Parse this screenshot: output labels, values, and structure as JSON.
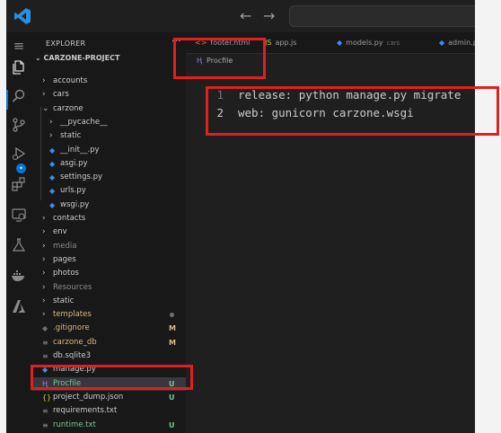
{
  "explorer": {
    "title": "EXPLORER",
    "more": "···",
    "project": "CARZONE-PROJECT",
    "items": [
      {
        "label": "accounts",
        "kind": "folder",
        "color": "#cccccc",
        "status": ""
      },
      {
        "label": "cars",
        "kind": "folder",
        "color": "#cccccc",
        "status": ""
      },
      {
        "label": "carzone",
        "kind": "folder-open",
        "color": "#cccccc",
        "status": ""
      },
      {
        "label": "__pycache__",
        "kind": "folder",
        "color": "#cccccc",
        "status": ""
      },
      {
        "label": "static",
        "kind": "folder",
        "color": "#cccccc",
        "status": ""
      },
      {
        "label": "__init__.py",
        "kind": "python",
        "color": "#cccccc",
        "status": ""
      },
      {
        "label": "asgi.py",
        "kind": "python",
        "color": "#cccccc",
        "status": ""
      },
      {
        "label": "settings.py",
        "kind": "python",
        "color": "#cccccc",
        "status": ""
      },
      {
        "label": "urls.py",
        "kind": "python",
        "color": "#cccccc",
        "status": ""
      },
      {
        "label": "wsgi.py",
        "kind": "python",
        "color": "#cccccc",
        "status": ""
      },
      {
        "label": "contacts",
        "kind": "folder",
        "color": "#cccccc",
        "status": ""
      },
      {
        "label": "env",
        "kind": "folder",
        "color": "#cccccc",
        "status": ""
      },
      {
        "label": "media",
        "kind": "folder",
        "color": "#8b8b8b",
        "status": ""
      },
      {
        "label": "pages",
        "kind": "folder",
        "color": "#cccccc",
        "status": ""
      },
      {
        "label": "photos",
        "kind": "folder",
        "color": "#cccccc",
        "status": ""
      },
      {
        "label": "Resources",
        "kind": "folder",
        "color": "#8b8b8b",
        "status": ""
      },
      {
        "label": "static",
        "kind": "folder",
        "color": "#cccccc",
        "status": ""
      },
      {
        "label": "templates",
        "kind": "folder",
        "color": "#d7ba7d",
        "status": "dot"
      },
      {
        "label": ".gitignore",
        "kind": "git",
        "color": "#d7ba7d",
        "status": "M"
      },
      {
        "label": "carzone_db",
        "kind": "file",
        "color": "#d7ba7d",
        "status": "M"
      },
      {
        "label": "db.sqlite3",
        "kind": "file",
        "color": "#cccccc",
        "status": ""
      },
      {
        "label": "manage.py",
        "kind": "python",
        "color": "#cccccc",
        "status": ""
      },
      {
        "label": "Procfile",
        "kind": "heroku",
        "color": "#73c991",
        "status": "U"
      },
      {
        "label": "project_dump.json",
        "kind": "json",
        "color": "#cccccc",
        "status": "U"
      },
      {
        "label": "requirements.txt",
        "kind": "txt",
        "color": "#cccccc",
        "status": ""
      },
      {
        "label": "runtime.txt",
        "kind": "txt",
        "color": "#73c991",
        "status": "U"
      }
    ]
  },
  "tabs": [
    {
      "label": "footer.html",
      "hint": "",
      "icon": "html-icon"
    },
    {
      "label": "app.js",
      "hint": "",
      "icon": "js-icon"
    },
    {
      "label": "models.py",
      "hint": "cars",
      "icon": "python-icon"
    },
    {
      "label": "admin.py",
      "hint": "",
      "icon": "python-icon"
    }
  ],
  "breadcrumb": "Procfile",
  "code_lines": [
    {
      "num": "1",
      "text": "release: python manage.py migrate"
    },
    {
      "num": "2",
      "text": "web: gunicorn carzone.wsgi"
    }
  ],
  "colors": {
    "accent": "#0078d4",
    "untracked": "#73c991",
    "modified": "#d7ba7d",
    "highlight": "#e0201c",
    "python": "#3b8eea",
    "heroku": "#9f7be1"
  },
  "icons": [
    "vscode-logo-icon",
    "arrow-left-icon",
    "arrow-right-icon",
    "files-icon",
    "search-icon",
    "source-control-icon",
    "run-debug-icon",
    "extensions-icon",
    "remote-explorer-icon",
    "testing-icon",
    "docker-icon",
    "azure-icon"
  ]
}
